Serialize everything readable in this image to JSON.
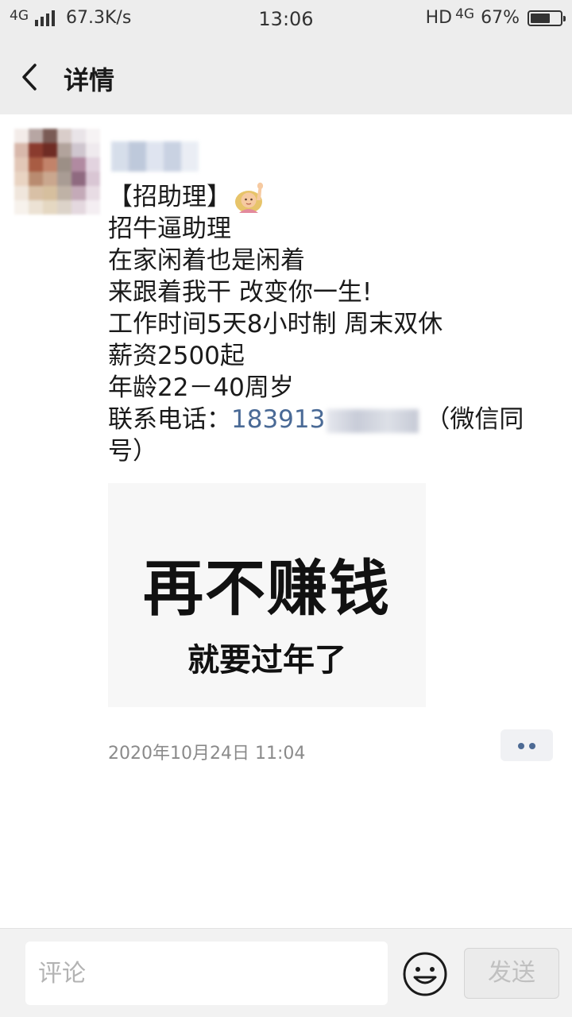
{
  "status_bar": {
    "network_left": "4G",
    "speed": "67.3K/s",
    "time": "13:06",
    "hd": "HD",
    "network_right": "4G",
    "battery_text": "67%",
    "battery_level": 0.67
  },
  "nav": {
    "back_icon": "chevron-left-icon",
    "title": "详情"
  },
  "post": {
    "line_1": "【招助理】",
    "line_2": "招牛逼助理",
    "line_3": "在家闲着也是闲着",
    "line_4": "来跟着我干  改变你一生!",
    "line_5": "工作时间5天8小时制 周末双休",
    "line_6": "薪资2500起",
    "line_7": "年龄22－40周岁",
    "contact_label": "联系电话：",
    "phone_visible": "183913",
    "contact_suffix": "（微信同",
    "line_9": "号）",
    "image_text_big": "再不赚钱",
    "image_text_small": "就要过年了",
    "timestamp": "2020年10月24日 11:04"
  },
  "comment_bar": {
    "placeholder": "评论",
    "emoji_icon": "smiley-face-icon",
    "send_label": "发送"
  }
}
